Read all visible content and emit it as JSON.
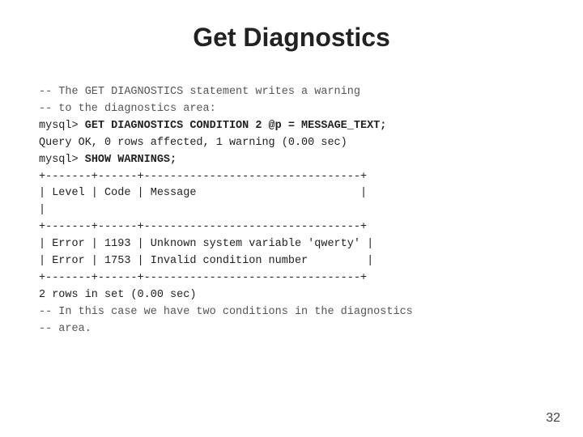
{
  "title": "Get Diagnostics",
  "code": {
    "line1": "-- The GET DIAGNOSTICS statement writes a warning",
    "line2": "-- to the diagnostics area:",
    "line3_prefix": "mysql> ",
    "line3_bold": "GET DIAGNOSTICS CONDITION 2 @p = MESSAGE_TEXT;",
    "line4": "Query OK, 0 rows affected, 1 warning (0.00 sec)",
    "line5_prefix": "mysql> ",
    "line5_bold": "SHOW WARNINGS;",
    "line6": "+-------+------+---------------------------------+",
    "line7": "| Level | Code | Message                         |",
    "line8": "|",
    "line9": "+-------+------+---------------------------------+",
    "line10": "| Error | 1193 | Unknown system variable 'qwerty' |",
    "line11": "| Error | 1753 | Invalid condition number         |",
    "line12": "+-------+------+---------------------------------+",
    "line13": "2 rows in set (0.00 sec)",
    "line14": "-- In this case we have two conditions in the diagnostics",
    "line15": "-- area."
  },
  "page_number": "32"
}
